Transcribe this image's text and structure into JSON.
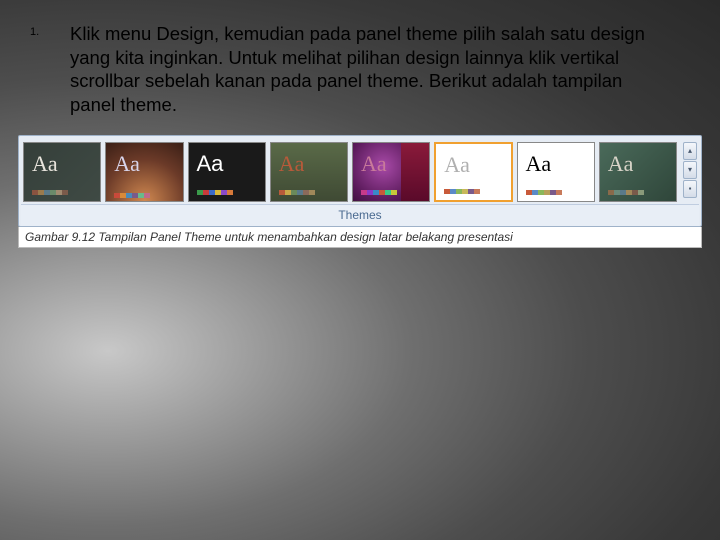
{
  "list": {
    "number": "1.",
    "body": "Klik menu Design, kemudian pada panel theme pilih salah satu design yang kita inginkan. Untuk melihat pilihan design lainnya klik vertikal scrollbar sebelah kanan pada panel theme. Berikut adalah tampilan panel theme."
  },
  "panel": {
    "label": "Themes",
    "caption": "Gambar 9.12 Tampilan Panel Theme untuk menambahkan design latar belakang presentasi",
    "aa": "Aa",
    "scroll_up": "▴",
    "scroll_down": "▾",
    "scroll_more": "▪"
  }
}
